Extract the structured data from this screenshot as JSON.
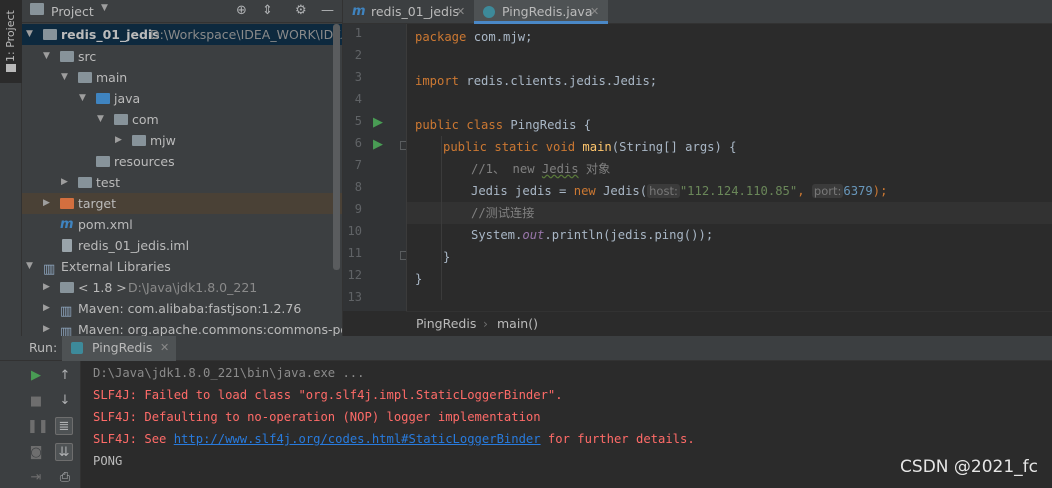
{
  "sidebar": {
    "label": "1: Project"
  },
  "project_panel": {
    "title": "Project",
    "tree": [
      {
        "label": "redis_01_jedis",
        "path": "D:\\Workspace\\IDEA_WORK\\IDEA",
        "bold": true
      },
      {
        "label": "src"
      },
      {
        "label": "main"
      },
      {
        "label": "java"
      },
      {
        "label": "com"
      },
      {
        "label": "mjw"
      },
      {
        "label": "resources"
      },
      {
        "label": "test"
      },
      {
        "label": "target"
      },
      {
        "label": "pom.xml"
      },
      {
        "label": "redis_01_jedis.iml"
      },
      {
        "label": "External Libraries"
      },
      {
        "label": "< 1.8 >",
        "path": "D:\\Java\\jdk1.8.0_221"
      },
      {
        "label": "Maven: com.alibaba:fastjson:1.2.76"
      },
      {
        "label": "Maven: org.apache.commons:commons-pool"
      }
    ]
  },
  "editor": {
    "tabs": [
      {
        "label": "redis_01_jedis"
      },
      {
        "label": "PingRedis.java"
      }
    ],
    "line_numbers": [
      "1",
      "2",
      "3",
      "4",
      "5",
      "6",
      "7",
      "8",
      "9",
      "10",
      "11",
      "12",
      "13"
    ],
    "code": {
      "l1_kw": "package",
      "l1_rest": " com.mjw;",
      "l3_kw": "import",
      "l3_rest": " redis.clients.jedis.Jedis;",
      "l5_kw": "public class",
      "l5_rest": " PingRedis {",
      "l6_kw": "public static void",
      "l6_fn": "main",
      "l6_rest": "(String[] args) {",
      "l7_comment": "//1、 new ",
      "l7_ul": "Jedis",
      "l7_tail": " 对象",
      "l8_a": "Jedis jedis = ",
      "l8_kw": "new",
      "l8_b": " Jedis(",
      "l8_hint1": "host:",
      "l8_str": "\"112.124.110.85\"",
      "l8_comma": ", ",
      "l8_hint2": "port:",
      "l8_num": "6379",
      "l8_end": ");",
      "l9_comment": "//测试连接",
      "l10_a": "System.",
      "l10_it": "out",
      "l10_b": ".println(jedis.ping());",
      "l11": "}",
      "l12": "}"
    },
    "breadcrumb": [
      "PingRedis",
      "main()"
    ]
  },
  "run": {
    "label": "Run:",
    "tab": "PingRedis",
    "console": [
      {
        "text": "D:\\Java\\jdk1.8.0_221\\bin\\java.exe ...",
        "kind": "cmd"
      },
      {
        "text": "SLF4J: Failed to load class \"org.slf4j.impl.StaticLoggerBinder\".",
        "kind": "err"
      },
      {
        "text": "SLF4J: Defaulting to no-operation (NOP) logger implementation",
        "kind": "err"
      },
      {
        "pre": "SLF4J: See ",
        "link": "http://www.slf4j.org/codes.html#StaticLoggerBinder",
        "post": " for further details.",
        "kind": "err"
      },
      {
        "text": "PONG",
        "kind": "out"
      }
    ]
  },
  "watermark": "CSDN @2021_fc",
  "colors": {
    "keyword": "#cc7832",
    "string": "#6a8759",
    "number": "#6897bb",
    "comment": "#808080",
    "error": "#ff6b68",
    "link": "#287bde"
  }
}
